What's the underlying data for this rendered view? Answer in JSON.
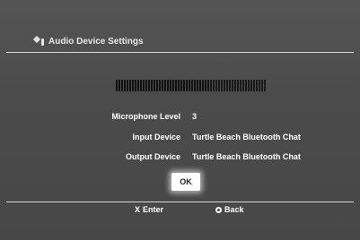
{
  "header": {
    "title": "Audio Device Settings",
    "icon": "settings-gear-icon"
  },
  "meter": {
    "level_fraction": 0.62,
    "segments_total": 56,
    "segments_filled": 35
  },
  "fields": [
    {
      "label": "Microphone Level",
      "value": "3"
    },
    {
      "label": "Input Device",
      "value": "Turtle Beach Bluetooth Chat"
    },
    {
      "label": "Output Device",
      "value": "Turtle Beach Bluetooth Chat"
    }
  ],
  "ok_button": {
    "label": "OK"
  },
  "footer": {
    "enter": {
      "button": "X",
      "label": "Enter"
    },
    "back": {
      "icon": "circle-button-icon",
      "label": "Back"
    }
  }
}
